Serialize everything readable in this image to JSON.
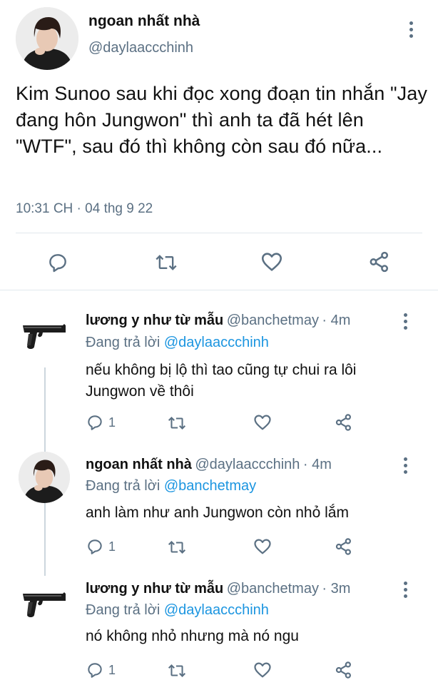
{
  "tweet": {
    "name": "ngoan nhất nhà",
    "handle": "@daylaaccchinh",
    "text": "Kim Sunoo sau khi đọc xong đoạn tin nhắn \"Jay đang hôn Jungwon\" thì anh  ta đã hét lên \"WTF\", sau đó thì không còn sau đó nữa...",
    "timestamp": "10:31 CH · 04 thg 9 22",
    "actions": {
      "reply_icon": "reply-bubble-icon",
      "retweet_icon": "retweet-icon",
      "like_icon": "heart-icon",
      "share_icon": "share-icon"
    }
  },
  "replies": [
    {
      "name": "lương y như từ mẫu",
      "handle": "@banchetmay",
      "age": "· 4m",
      "replying_prefix": "Đang trả lời",
      "replying_to": "@daylaaccchinh",
      "text": "nếu không bị lộ thì tao cũng tự chui ra lôi Jungwon về thôi",
      "reply_count": "1",
      "avatar": "pistol-icon"
    },
    {
      "name": "ngoan nhất nhà",
      "handle": "@daylaaccchinh",
      "age": "· 4m",
      "replying_prefix": "Đang trả lời",
      "replying_to": "@banchetmay",
      "text": "anh làm như anh Jungwon còn nhỏ lắm",
      "reply_count": "1",
      "avatar": "user-photo"
    },
    {
      "name": "lương y như từ mẫu",
      "handle": "@banchetmay",
      "age": "· 3m",
      "replying_prefix": "Đang trả lời",
      "replying_to": "@daylaaccchinh",
      "text": "nó không nhỏ nhưng mà nó ngu",
      "reply_count": "1",
      "avatar": "pistol-icon"
    }
  ],
  "colors": {
    "text": "#14171a",
    "secondary": "#5b7083",
    "link": "#1b95e0",
    "divider": "#e1e8ed"
  }
}
